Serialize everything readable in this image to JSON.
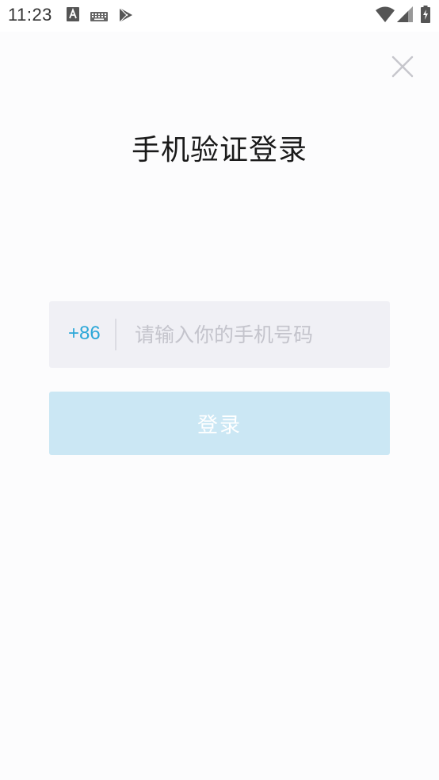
{
  "status_bar": {
    "time": "11:23",
    "icons": [
      "a-badge-icon",
      "keyboard-icon",
      "play-store-icon",
      "wifi-icon",
      "signal-icon",
      "battery-charging-icon"
    ]
  },
  "page": {
    "title": "手机验证登录",
    "close_icon": "close-icon"
  },
  "phone_field": {
    "country_code": "+86",
    "placeholder": "请输入你的手机号码",
    "value": ""
  },
  "login_button": {
    "label": "登录"
  },
  "colors": {
    "accent": "#2ba7d8",
    "button_disabled": "#cbe7f4",
    "field_bg": "#f0f0f5",
    "placeholder": "#c4c4cc"
  }
}
